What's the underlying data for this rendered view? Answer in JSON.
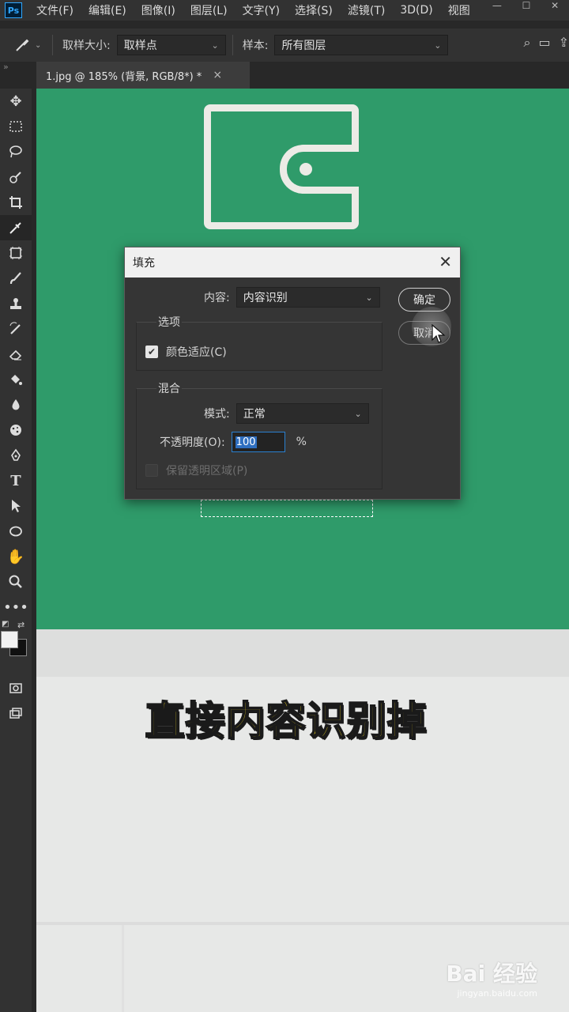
{
  "menubar": {
    "logo": "Ps",
    "items": [
      "文件(F)",
      "编辑(E)",
      "图像(I)",
      "图层(L)",
      "文字(Y)",
      "选择(S)",
      "滤镜(T)",
      "3D(D)",
      "视图"
    ]
  },
  "optbar": {
    "sample_size_label": "取样大小:",
    "sample_size_value": "取样点",
    "sample_label": "样本:",
    "sample_value": "所有图层"
  },
  "tab": {
    "title": "1.jpg @ 185% (背景, RGB/8*) *",
    "close": "×"
  },
  "dialog": {
    "title": "填充",
    "content_label": "内容:",
    "content_value": "内容识别",
    "ok_label": "确定",
    "cancel_label": "取消",
    "options_group": "选项",
    "color_adapt_label": "颜色适应(C)",
    "color_adapt_checked": true,
    "blend_group": "混合",
    "mode_label": "模式:",
    "mode_value": "正常",
    "opacity_label": "不透明度(O):",
    "opacity_value": "100",
    "opacity_unit": "%",
    "preserve_label": "保留透明区域(P)",
    "preserve_checked": false
  },
  "canvas": {
    "caption": "直接内容识别掉",
    "watermark_main": "Bai  经验",
    "watermark_sub": "jingyan.baidu.com"
  },
  "colors": {
    "canvas_green": "#2f9b6a",
    "caption_yellow": "#f4dc22",
    "selection_blue": "#2f6fc0"
  }
}
